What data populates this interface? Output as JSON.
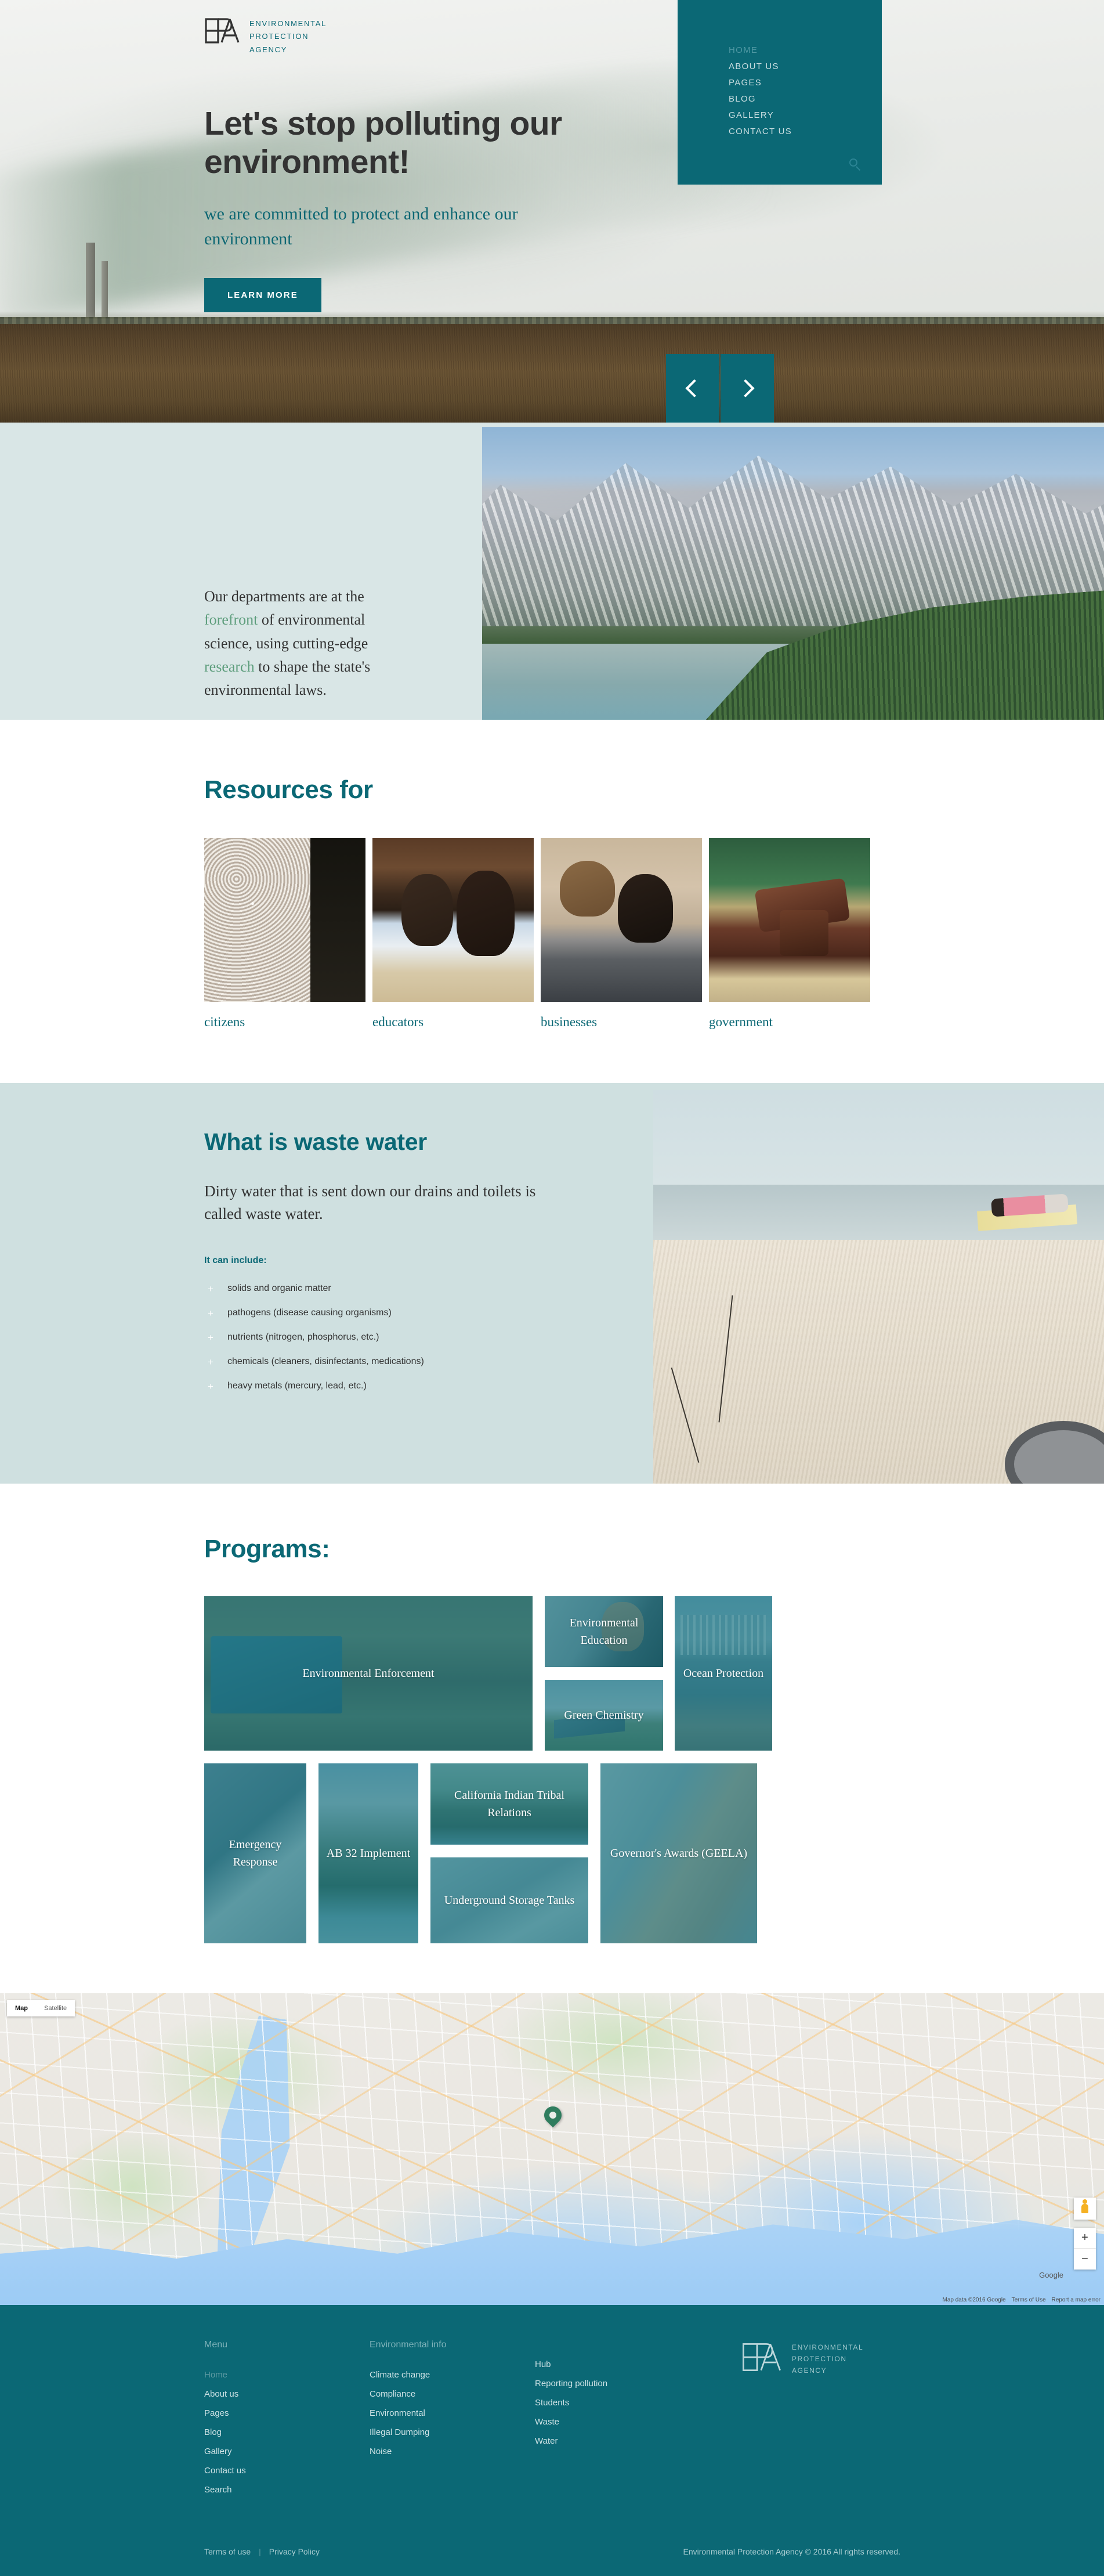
{
  "brand": {
    "mark": "EPA",
    "line1": "ENVIRONMENTAL",
    "line2": "PROTECTION",
    "line3": "AGENCY"
  },
  "nav": {
    "items": [
      {
        "label": "HOME",
        "active": true
      },
      {
        "label": "ABOUT US",
        "active": false
      },
      {
        "label": "PAGES",
        "active": false
      },
      {
        "label": "BLOG",
        "active": false
      },
      {
        "label": "GALLERY",
        "active": false
      },
      {
        "label": "CONTACT US",
        "active": false
      }
    ],
    "search_icon": "search-icon"
  },
  "hero": {
    "title": "Let's stop polluting our environment!",
    "subtitle": "we are committed to protect and enhance our environment",
    "cta": "LEARN MORE",
    "prev_icon": "chevron-left-icon",
    "next_icon": "chevron-right-icon"
  },
  "departments": {
    "text_1": "Our departments are at the ",
    "hl_1": "forefront",
    "text_2": " of environmental science, using cutting-edge ",
    "hl_2": "research",
    "text_3": " to shape the state's environmental laws."
  },
  "resources": {
    "title": "Resources for",
    "cards": [
      {
        "label": "citizens"
      },
      {
        "label": "educators"
      },
      {
        "label": "businesses"
      },
      {
        "label": "government"
      }
    ]
  },
  "waste": {
    "title": "What is waste water",
    "paragraph": "Dirty water that is sent down our drains and toilets is called waste water.",
    "list_heading": "It can include:",
    "items": [
      "solids and organic matter",
      "pathogens (disease causing organisms)",
      "nutrients (nitrogen, phosphorus, etc.)",
      "chemicals (cleaners, disinfectants, medications)",
      "heavy metals (mercury, lead, etc.)"
    ]
  },
  "programs": {
    "title": "Programs:",
    "tiles": [
      {
        "label": "Environmental Enforcement"
      },
      {
        "label": "Environmental Education"
      },
      {
        "label": "Green Chemistry"
      },
      {
        "label": "Ocean Protection"
      },
      {
        "label": "Emergency Response"
      },
      {
        "label": "AB 32 Implement"
      },
      {
        "label": "California Indian Tribal Relations"
      },
      {
        "label": "Underground Storage Tanks"
      },
      {
        "label": "Governor's Awards (GEELA)"
      }
    ]
  },
  "map": {
    "type_map": "Map",
    "type_satellite": "Satellite",
    "pegman_icon": "pegman-icon",
    "zoom_in": "+",
    "zoom_out": "−",
    "google_label": "Google",
    "attribution": "Map data ©2016 Google",
    "terms": "Terms of Use",
    "report": "Report a map error",
    "marker_icon": "map-marker-icon"
  },
  "footer": {
    "columns": [
      {
        "heading": "Menu",
        "links": [
          {
            "label": "Home",
            "active": true
          },
          {
            "label": "About us",
            "active": false
          },
          {
            "label": "Pages",
            "active": false
          },
          {
            "label": "Blog",
            "active": false
          },
          {
            "label": "Gallery",
            "active": false
          },
          {
            "label": "Contact us",
            "active": false
          },
          {
            "label": "Search",
            "active": false
          }
        ]
      },
      {
        "heading": "Environmental info",
        "links": [
          {
            "label": "Climate change",
            "active": false
          },
          {
            "label": "Compliance",
            "active": false
          },
          {
            "label": "Environmental",
            "active": false
          },
          {
            "label": "Illegal Dumping",
            "active": false
          },
          {
            "label": "Noise",
            "active": false
          }
        ]
      },
      {
        "heading": "",
        "links": [
          {
            "label": "Hub",
            "active": false
          },
          {
            "label": "Reporting pollution",
            "active": false
          },
          {
            "label": "Students",
            "active": false
          },
          {
            "label": "Waste",
            "active": false
          },
          {
            "label": "Water",
            "active": false
          }
        ]
      }
    ],
    "terms": "Terms of use",
    "separator": "|",
    "privacy": "Privacy Policy",
    "copyright": "Environmental Protection Agency © 2016 All rights reserved."
  },
  "colors": {
    "teal": "#0b6875",
    "teal_light": "#cfe3e6",
    "pale_mint": "#d9e6e6",
    "pale_blue": "#cfe0e0",
    "green_accent": "#5e9e7d",
    "nav_active": "#4f98a3"
  }
}
